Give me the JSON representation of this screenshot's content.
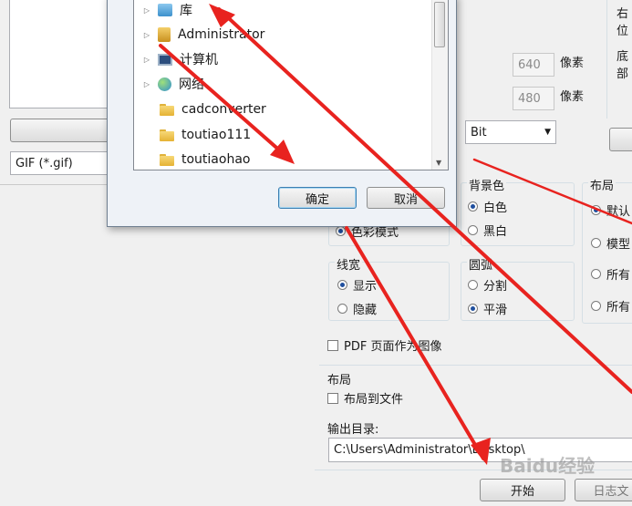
{
  "left_panel": {
    "format_select": "GIF (*.gif)"
  },
  "right_panel": {
    "top_right_label_1": "右位",
    "top_right_label_2": "底部",
    "width_value": "640",
    "height_value": "480",
    "pixel_unit": "像素",
    "color_depth": "Bit"
  },
  "background_group": {
    "title": "背景色",
    "options": [
      "白色",
      "黑白"
    ],
    "selected": 0
  },
  "color_mode_partial": "色彩模式",
  "layout_group": {
    "title": "布局",
    "options": [
      "默认",
      "模型",
      "所有",
      "所有"
    ],
    "selected": 0
  },
  "linewidth_group": {
    "title": "线宽",
    "options": [
      "显示",
      "隐藏"
    ],
    "selected": 0
  },
  "arc_group": {
    "title": "圆弧",
    "options": [
      "分割",
      "平滑"
    ],
    "selected": 1
  },
  "pdf_checkbox": "PDF 页面作为图像",
  "layout2": {
    "title": "布局",
    "checkbox": "布局到文件"
  },
  "output": {
    "label": "输出目录:",
    "path": "C:\\Users\\Administrator\\Desktop\\"
  },
  "buttons": {
    "start": "开始",
    "log": "日志文"
  },
  "watermark": "Baidu经验",
  "dialog": {
    "tree": [
      {
        "label": "库",
        "icon": "library-icon",
        "expandable": true
      },
      {
        "label": "Administrator",
        "icon": "user-folder-icon",
        "expandable": true
      },
      {
        "label": "计算机",
        "icon": "computer-icon",
        "expandable": true
      },
      {
        "label": "网络",
        "icon": "network-icon",
        "expandable": true
      },
      {
        "label": "cadconverter",
        "icon": "folder-icon",
        "expandable": false
      },
      {
        "label": "toutiao111",
        "icon": "folder-icon",
        "expandable": false
      },
      {
        "label": "toutiaohao",
        "icon": "folder-icon",
        "expandable": false
      }
    ],
    "ok": "确定",
    "cancel": "取消"
  },
  "colors": {
    "arrow": "#e8231f",
    "selection": "#1f4f9e"
  }
}
